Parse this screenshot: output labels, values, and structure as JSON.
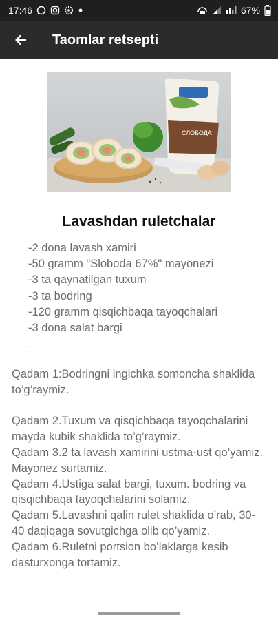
{
  "status_bar": {
    "time": "17:46",
    "battery": "67%",
    "icons": [
      "whatsapp-icon",
      "instagram-icon",
      "settings-icon",
      "dot-icon",
      "hotspot-icon",
      "signal-icon",
      "data-icon",
      "battery-icon"
    ]
  },
  "app_bar": {
    "title": "Taomlar retsepti",
    "back_icon": "arrow-back-icon"
  },
  "recipe": {
    "title": "Lavashdan ruletchalar",
    "ingredients": [
      "-2 dona lavash xamiri",
      "-50 gramm \"Sloboda 67%\" mayonezi",
      "-3 ta qaynatilgan tuxum",
      "-3 ta bodring",
      "-120 gramm qisqichbaqa tayoqchalari",
      "-3 dona salat bargi",
      "."
    ],
    "steps": [
      "Qadam 1:Bodringni ingichka somoncha shaklida to’g’raymiz.",
      "Qadam 2.Tuxum va qisqichbaqa tayoqchalarini mayda kubik shaklida to’g’raymiz.",
      "Qadam 3.2 ta lavash xamirini ustma-ust qo’yamiz. Mayonez surtamiz.",
      "Qadam 4.Ustiga salat bargi, tuxum. bodring va qisqichbaqa tayoqchalarini solamiz.",
      "Qadam 5.Lavashni qalin rulet shaklida o’rab, 30-40 daqiqaga sovutgichga olib qo’yamiz.",
      "Qadam 6.Ruletni portsion bo’laklarga kesib dasturxonga tortamiz."
    ]
  },
  "image": {
    "subject": "lavash-rolls-with-mayonnaise-package",
    "package_brand": "СЛОБОДА"
  }
}
